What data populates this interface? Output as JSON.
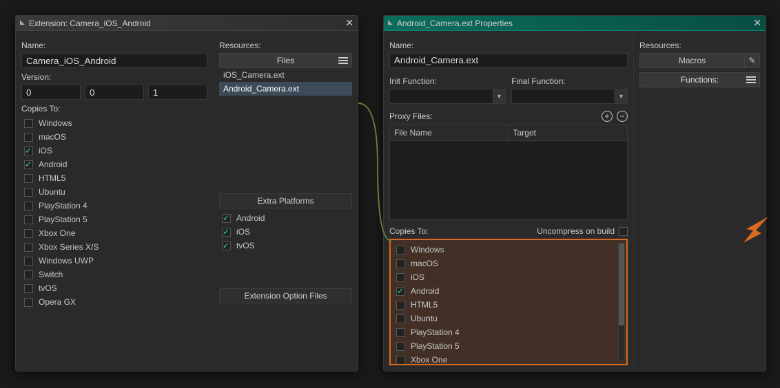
{
  "left": {
    "title": "Extension: Camera_iOS_Android",
    "name_label": "Name:",
    "name_value": "Camera_iOS_Android",
    "version_label": "Version:",
    "version": [
      "0",
      "0",
      "1"
    ],
    "copies_label": "Copies To:",
    "platforms": [
      {
        "label": "Windows",
        "checked": false
      },
      {
        "label": "macOS",
        "checked": false
      },
      {
        "label": "iOS",
        "checked": true
      },
      {
        "label": "Android",
        "checked": true
      },
      {
        "label": "HTML5",
        "checked": false
      },
      {
        "label": "Ubuntu",
        "checked": false
      },
      {
        "label": "PlayStation 4",
        "checked": false
      },
      {
        "label": "PlayStation 5",
        "checked": false
      },
      {
        "label": "Xbox One",
        "checked": false
      },
      {
        "label": "Xbox Series X/S",
        "checked": false
      },
      {
        "label": "Windows UWP",
        "checked": false
      },
      {
        "label": "Switch",
        "checked": false
      },
      {
        "label": "tvOS",
        "checked": false
      },
      {
        "label": "Opera GX",
        "checked": false
      }
    ],
    "resources_label": "Resources:",
    "files_header": "Files",
    "files": [
      {
        "name": "iOS_Camera.ext",
        "selected": false
      },
      {
        "name": "Android_Camera.ext",
        "selected": true
      }
    ],
    "extra_platforms_header": "Extra Platforms",
    "extra_platforms": [
      {
        "label": "Android",
        "checked": true
      },
      {
        "label": "iOS",
        "checked": true
      },
      {
        "label": "tvOS",
        "checked": true
      }
    ],
    "ext_option_files_header": "Extension Option Files"
  },
  "right": {
    "title": "Android_Camera.ext Properties",
    "name_label": "Name:",
    "name_value": "Android_Camera.ext",
    "init_label": "Init Function:",
    "final_label": "Final Function:",
    "proxy_label": "Proxy Files:",
    "table_headers": {
      "filename": "File Name",
      "target": "Target"
    },
    "copies_label": "Copies To:",
    "uncompress_label": "Uncompress on build",
    "uncompress_checked": false,
    "platforms": [
      {
        "label": "Windows",
        "checked": false
      },
      {
        "label": "macOS",
        "checked": false
      },
      {
        "label": "iOS",
        "checked": false
      },
      {
        "label": "Android",
        "checked": true
      },
      {
        "label": "HTML5",
        "checked": false
      },
      {
        "label": "Ubuntu",
        "checked": false
      },
      {
        "label": "PlayStation 4",
        "checked": false
      },
      {
        "label": "PlayStation 5",
        "checked": false
      },
      {
        "label": "Xbox One",
        "checked": false
      }
    ],
    "resources_label": "Resources:",
    "macros_label": "Macros",
    "functions_header": "Functions:"
  }
}
